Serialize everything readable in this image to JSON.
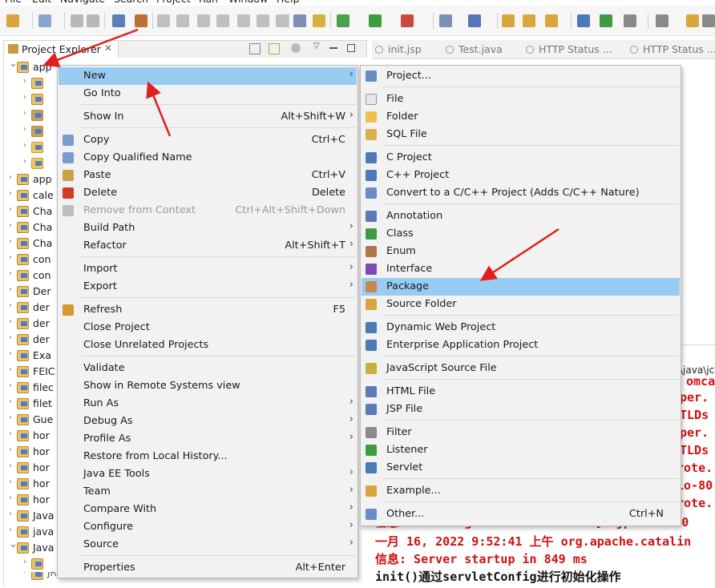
{
  "menubar": {
    "items": [
      "File",
      "Edit",
      "Navigate",
      "Search",
      "Project",
      "Run",
      "Window",
      "Help"
    ]
  },
  "project_explorer": {
    "tab_label": "Project Explorer",
    "tab_close": "✕",
    "tree": [
      {
        "label": "app",
        "expanded": true
      },
      {
        "label": "",
        "icon": "package-icon"
      },
      {
        "label": "",
        "icon": "package-icon"
      },
      {
        "label": "",
        "icon": "library-icon"
      },
      {
        "label": "",
        "icon": "library-icon"
      },
      {
        "label": "",
        "icon": "folder-icon"
      },
      {
        "label": "",
        "icon": "folder-icon"
      },
      {
        "label": "app"
      },
      {
        "label": "cale"
      },
      {
        "label": "Cha"
      },
      {
        "label": "Cha"
      },
      {
        "label": "Cha"
      },
      {
        "label": "con"
      },
      {
        "label": "con"
      },
      {
        "label": "Der"
      },
      {
        "label": "der"
      },
      {
        "label": "der"
      },
      {
        "label": "der"
      },
      {
        "label": "Exa"
      },
      {
        "label": "FEIC"
      },
      {
        "label": "filec"
      },
      {
        "label": "filet"
      },
      {
        "label": "Gue"
      },
      {
        "label": "hor"
      },
      {
        "label": "hor"
      },
      {
        "label": "hor"
      },
      {
        "label": "hor"
      },
      {
        "label": "hor"
      },
      {
        "label": "Java"
      },
      {
        "label": "java"
      },
      {
        "label": "Java"
      },
      {
        "label": ""
      },
      {
        "label": "JRE System Library [JavaSE-1.8]"
      }
    ]
  },
  "editor_tabs": [
    "init.jsp",
    "Test.java",
    "HTTP Status ...",
    "HTTP Status ..."
  ],
  "context_menu": [
    {
      "label": "New",
      "shortcut": "",
      "submenu": true,
      "highlight": true
    },
    {
      "label": "Go Into",
      "shortcut": ""
    },
    {
      "label": "Show In",
      "shortcut": "Alt+Shift+W",
      "submenu": true
    },
    {
      "label": "Copy",
      "shortcut": "Ctrl+C",
      "icon": "copy-icon"
    },
    {
      "label": "Copy Qualified Name",
      "shortcut": "",
      "icon": "copy-icon"
    },
    {
      "label": "Paste",
      "shortcut": "Ctrl+V",
      "icon": "paste-icon"
    },
    {
      "label": "Delete",
      "shortcut": "Delete",
      "icon": "delete-icon"
    },
    {
      "label": "Remove from Context",
      "shortcut": "Ctrl+Alt+Shift+Down",
      "disabled": true,
      "icon": "remove-icon"
    },
    {
      "label": "Build Path",
      "shortcut": "",
      "submenu": true
    },
    {
      "label": "Refactor",
      "shortcut": "Alt+Shift+T",
      "submenu": true
    },
    {
      "label": "Import",
      "shortcut": "",
      "submenu": true
    },
    {
      "label": "Export",
      "shortcut": "",
      "submenu": true
    },
    {
      "label": "Refresh",
      "shortcut": "F5",
      "icon": "refresh-icon"
    },
    {
      "label": "Close Project",
      "shortcut": ""
    },
    {
      "label": "Close Unrelated Projects",
      "shortcut": ""
    },
    {
      "label": "Validate",
      "shortcut": ""
    },
    {
      "label": "Show in Remote Systems view",
      "shortcut": ""
    },
    {
      "label": "Run As",
      "shortcut": "",
      "submenu": true
    },
    {
      "label": "Debug As",
      "shortcut": "",
      "submenu": true
    },
    {
      "label": "Profile As",
      "shortcut": "",
      "submenu": true
    },
    {
      "label": "Restore from Local History...",
      "shortcut": ""
    },
    {
      "label": "Java EE Tools",
      "shortcut": "",
      "submenu": true
    },
    {
      "label": "Team",
      "shortcut": "",
      "submenu": true
    },
    {
      "label": "Compare With",
      "shortcut": "",
      "submenu": true
    },
    {
      "label": "Configure",
      "shortcut": "",
      "submenu": true
    },
    {
      "label": "Source",
      "shortcut": "",
      "submenu": true
    },
    {
      "label": "Properties",
      "shortcut": "Alt+Enter"
    }
  ],
  "new_submenu": [
    {
      "label": "Project...",
      "shortcut": "",
      "icon": "project-icon"
    },
    {
      "label": "File",
      "shortcut": "",
      "icon": "file-icon"
    },
    {
      "label": "Folder",
      "shortcut": "",
      "icon": "folder-icon"
    },
    {
      "label": "SQL File",
      "shortcut": "",
      "icon": "sql-file-icon"
    },
    {
      "label": "C Project",
      "shortcut": "",
      "icon": "c-project-icon"
    },
    {
      "label": "C++ Project",
      "shortcut": "",
      "icon": "cpp-project-icon"
    },
    {
      "label": "Convert to a C/C++ Project (Adds C/C++ Nature)",
      "shortcut": "",
      "icon": "convert-icon"
    },
    {
      "label": "Annotation",
      "shortcut": "",
      "icon": "annotation-icon"
    },
    {
      "label": "Class",
      "shortcut": "",
      "icon": "class-icon"
    },
    {
      "label": "Enum",
      "shortcut": "",
      "icon": "enum-icon"
    },
    {
      "label": "Interface",
      "shortcut": "",
      "icon": "interface-icon"
    },
    {
      "label": "Package",
      "shortcut": "",
      "icon": "package-icon",
      "highlight": true
    },
    {
      "label": "Source Folder",
      "shortcut": "",
      "icon": "source-folder-icon"
    },
    {
      "label": "Dynamic Web Project",
      "shortcut": "",
      "icon": "web-project-icon"
    },
    {
      "label": "Enterprise Application Project",
      "shortcut": "",
      "icon": "ear-project-icon"
    },
    {
      "label": "JavaScript Source File",
      "shortcut": "",
      "icon": "js-file-icon"
    },
    {
      "label": "HTML File",
      "shortcut": "",
      "icon": "html-file-icon"
    },
    {
      "label": "JSP File",
      "shortcut": "",
      "icon": "jsp-file-icon"
    },
    {
      "label": "Filter",
      "shortcut": "",
      "icon": "filter-icon"
    },
    {
      "label": "Listener",
      "shortcut": "",
      "icon": "listener-icon"
    },
    {
      "label": "Servlet",
      "shortcut": "",
      "icon": "servlet-icon"
    },
    {
      "label": "Example...",
      "shortcut": "",
      "icon": "example-icon"
    },
    {
      "label": "Other...",
      "shortcut": "Ctrl+N",
      "icon": "other-icon"
    }
  ],
  "console": {
    "lines": [
      {
        "text": "\\java\\jc",
        "color": "#222222"
      },
      {
        "text": "omca",
        "color": "#d01010"
      },
      {
        "text": "per.",
        "color": "#d01010"
      },
      {
        "text": "TLDs",
        "color": "#d01010"
      },
      {
        "text": "per.",
        "color": "#d01010"
      },
      {
        "text": "TLDs",
        "color": "#d01010"
      },
      {
        "text": "rote.",
        "color": "#d01010"
      },
      {
        "text": "io-80",
        "color": "#d01010"
      },
      {
        "text": "rote.",
        "color": "#d01010"
      },
      {
        "text": "信息: Starting ProtocolHandler [\"ajp-nio-800",
        "color": "#d01010"
      },
      {
        "text": "一月 16, 2022 9:52:41 上午 org.apache.catalin",
        "color": "#d01010"
      },
      {
        "text": "信息: Server startup in 849 ms",
        "color": "#d01010"
      },
      {
        "text": "init()通过servletConfig进行初始化操作",
        "color": "#111111"
      }
    ]
  },
  "colors": {
    "highlight": "#99ccf3",
    "menu_bg": "#f2f2f2",
    "annotation_arrow": "#e0201c",
    "console_error": "#d01010"
  }
}
